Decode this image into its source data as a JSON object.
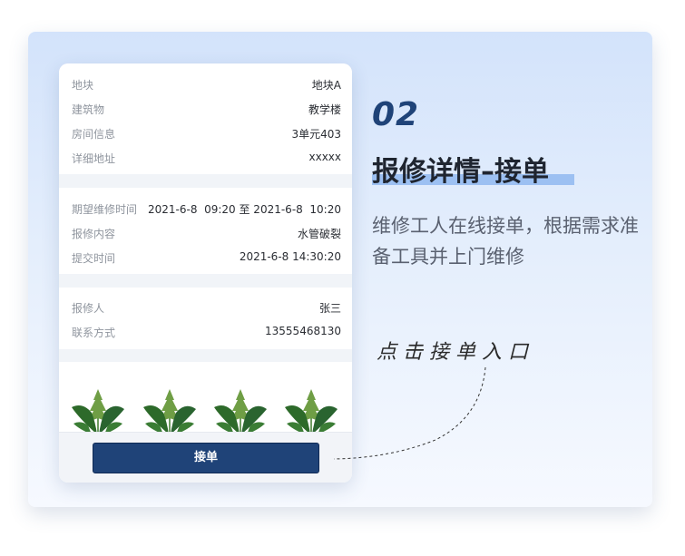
{
  "location_card": {
    "rows": [
      {
        "label": "地块",
        "value": "地块A"
      },
      {
        "label": "建筑物",
        "value": "教学楼"
      },
      {
        "label": "房间信息",
        "value": "3单元403"
      },
      {
        "label": "详细地址",
        "value": "xxxxx"
      }
    ]
  },
  "repair_card": {
    "rows": [
      {
        "label": "期望维修时间",
        "value": "2021-6-8  09:20 至 2021-6-8  10:20"
      },
      {
        "label": "报修内容",
        "value": "水管破裂"
      },
      {
        "label": "提交时间",
        "value": "2021-6-8 14:30:20"
      }
    ]
  },
  "contact_card": {
    "rows": [
      {
        "label": "报修人",
        "value": "张三"
      },
      {
        "label": "联系方式",
        "value": "13555468130"
      }
    ]
  },
  "accept_button": {
    "label": "接单"
  },
  "step": {
    "number": "02",
    "title": "报修详情–接单",
    "description": "维修工人在线接单，根据需求准备工具并上门维修"
  },
  "callout": {
    "text": "点击接单入口"
  },
  "colors": {
    "primary": "#1f4378",
    "highlight": "#9cc0f2",
    "background_top": "#d3e3fb",
    "leaf": "#2f6b2f"
  },
  "icons": [
    "monstera-leaf-icon",
    "fern-leaf-icon"
  ]
}
